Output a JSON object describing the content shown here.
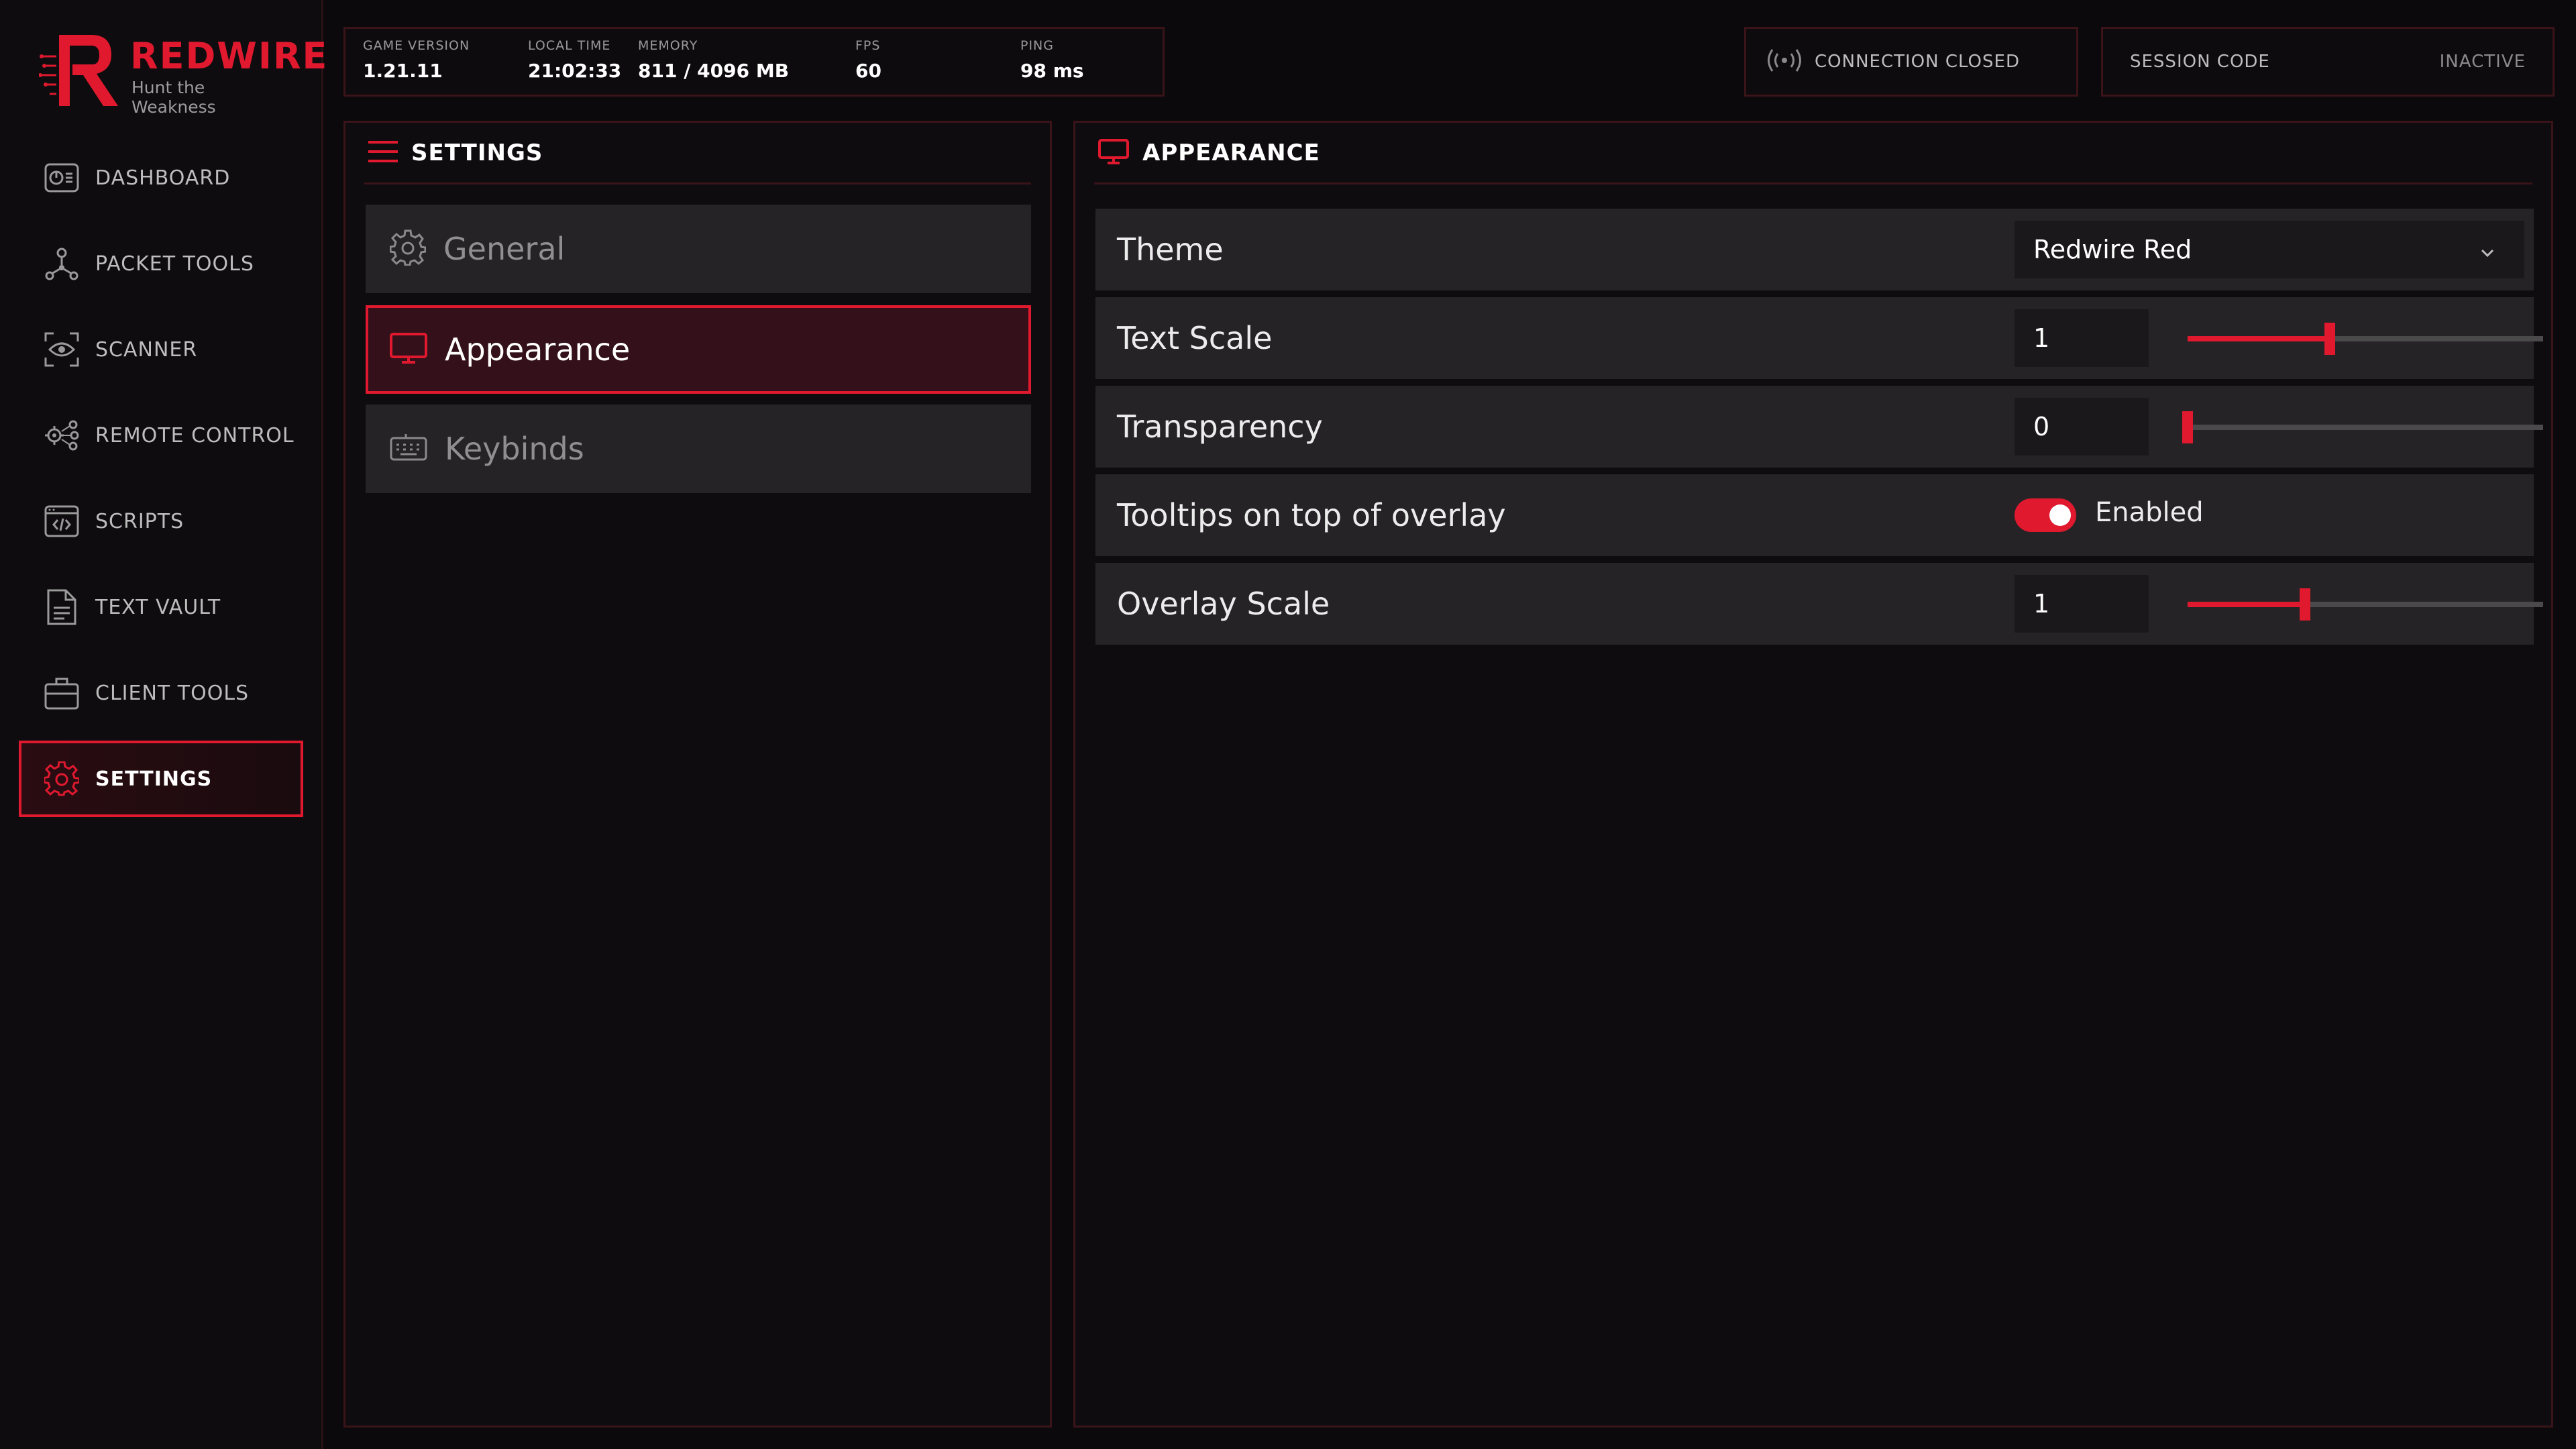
{
  "brand": {
    "title": "REDWIRE",
    "tagline": "Hunt the Weakness",
    "accent": "#e0192f"
  },
  "sidebar": {
    "items": [
      {
        "label": "DASHBOARD",
        "icon": "dashboard-icon"
      },
      {
        "label": "PACKET TOOLS",
        "icon": "network-nodes-icon"
      },
      {
        "label": "SCANNER",
        "icon": "eye-scan-icon"
      },
      {
        "label": "REMOTE CONTROL",
        "icon": "gear-network-icon"
      },
      {
        "label": "SCRIPTS",
        "icon": "code-window-icon"
      },
      {
        "label": "TEXT VAULT",
        "icon": "document-icon"
      },
      {
        "label": "CLIENT TOOLS",
        "icon": "briefcase-icon"
      },
      {
        "label": "SETTINGS",
        "icon": "gear-icon",
        "active": true
      }
    ]
  },
  "stats": {
    "game_version": {
      "label": "GAME VERSION",
      "value": "1.21.11"
    },
    "local_time": {
      "label": "LOCAL TIME",
      "value": "21:02:33"
    },
    "memory": {
      "label": "MEMORY",
      "value": "811 / 4096 MB"
    },
    "fps": {
      "label": "FPS",
      "value": "60"
    },
    "ping": {
      "label": "PING",
      "value": "98 ms"
    }
  },
  "connection": {
    "status": "CONNECTION CLOSED",
    "icon": "broadcast-icon"
  },
  "session": {
    "label": "SESSION CODE",
    "value": "INACTIVE"
  },
  "settings_panel": {
    "title": "SETTINGS",
    "items": [
      {
        "label": "General",
        "icon": "gear-icon"
      },
      {
        "label": "Appearance",
        "icon": "monitor-icon",
        "active": true
      },
      {
        "label": "Keybinds",
        "icon": "keyboard-icon"
      }
    ]
  },
  "appearance_panel": {
    "title": "APPEARANCE",
    "theme": {
      "label": "Theme",
      "value": "Redwire Red"
    },
    "text_scale": {
      "label": "Text Scale",
      "value": "1",
      "slider_fraction": 0.4
    },
    "transparency": {
      "label": "Transparency",
      "value": "0",
      "slider_fraction": 0.0
    },
    "tooltips": {
      "label": "Tooltips on top of overlay",
      "state": "Enabled"
    },
    "overlay_scale": {
      "label": "Overlay Scale",
      "value": "1",
      "slider_fraction": 0.33
    }
  }
}
